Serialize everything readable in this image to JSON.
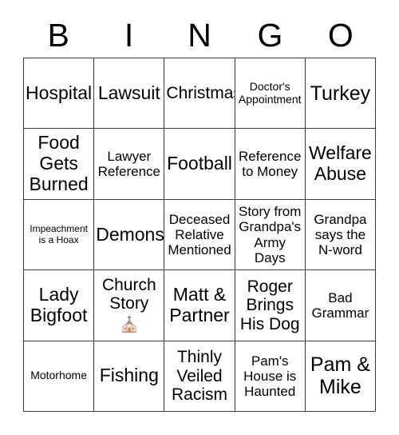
{
  "header": {
    "letters": [
      "B",
      "I",
      "N",
      "G",
      "O"
    ]
  },
  "grid": {
    "rows": [
      {
        "cells": [
          {
            "text": "Hospital",
            "size": "fs-lg"
          },
          {
            "text": "Lawsuit",
            "size": "fs-lg"
          },
          {
            "text": "Christmas",
            "size": "fs-md"
          },
          {
            "text": "Doctor's\nAppointment",
            "size": "fs-xs"
          },
          {
            "text": "Turkey",
            "size": "fs-xl"
          }
        ]
      },
      {
        "cells": [
          {
            "text": "Food\nGets\nBurned",
            "size": "fs-lg"
          },
          {
            "text": "Lawyer\nReference",
            "size": "fs-sm"
          },
          {
            "text": "Football",
            "size": "fs-lg"
          },
          {
            "text": "Reference\nto Money",
            "size": "fs-sm"
          },
          {
            "text": "Welfare\nAbuse",
            "size": "fs-lg"
          }
        ]
      },
      {
        "cells": [
          {
            "text": "Impeachment\nis a Hoax",
            "size": "fs-xxs"
          },
          {
            "text": "Demons",
            "size": "fs-lg"
          },
          {
            "text": "Deceased\nRelative\nMentioned",
            "size": "fs-sm"
          },
          {
            "text": "Story from\nGrandpa's\nArmy\nDays",
            "size": "fs-sm"
          },
          {
            "text": "Grandpa\nsays the\nN-word",
            "size": "fs-sm"
          }
        ]
      },
      {
        "cells": [
          {
            "text": "Lady\nBigfoot",
            "size": "fs-lg"
          },
          {
            "text": "Church\nStory",
            "size": "fs-md",
            "emoji": "church-emoji"
          },
          {
            "text": "Matt &\nPartner",
            "size": "fs-lg"
          },
          {
            "text": "Roger\nBrings\nHis Dog",
            "size": "fs-md"
          },
          {
            "text": "Bad\nGrammar",
            "size": "fs-sm"
          }
        ]
      },
      {
        "cells": [
          {
            "text": "Motorhome",
            "size": "fs-xs"
          },
          {
            "text": "Fishing",
            "size": "fs-lg"
          },
          {
            "text": "Thinly\nVeiled\nRacism",
            "size": "fs-md"
          },
          {
            "text": "Pam's\nHouse is\nHaunted",
            "size": "fs-sm"
          },
          {
            "text": "Pam &\nMike",
            "size": "fs-xl"
          }
        ]
      }
    ]
  },
  "colors": {
    "grid_line": "#3a3a3a",
    "text": "#000000",
    "background": "#ffffff",
    "church_roof": "#b08878",
    "church_wall": "#f2ece8",
    "church_door": "#d07d3c",
    "church_cross": "#8a6a5c"
  }
}
